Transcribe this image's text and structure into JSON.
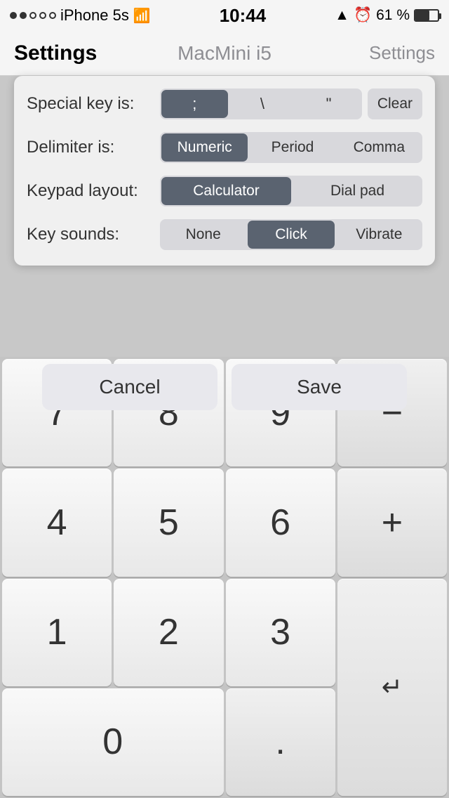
{
  "statusBar": {
    "carrier": "iPhone 5s",
    "time": "10:44",
    "battery": "61 %"
  },
  "navBar": {
    "titleLeft": "Settings",
    "titleCenter": "MacMini i5",
    "titleRight": "Settings"
  },
  "settings": {
    "specialKeyLabel": "Special key is:",
    "delimiterLabel": "Delimiter is:",
    "keypadLayoutLabel": "Keypad layout:",
    "keySoundsLabel": "Key sounds:",
    "specialKeyOptions": [
      ";",
      "\\",
      "\""
    ],
    "specialKeyActiveIndex": 0,
    "clearLabel": "Clear",
    "delimiterOptions": [
      "Numeric",
      "Period",
      "Comma"
    ],
    "delimiterActiveIndex": 0,
    "keypadOptions": [
      "Calculator",
      "Dial pad"
    ],
    "keypadActiveIndex": 0,
    "keySoundsOptions": [
      "None",
      "Click",
      "Vibrate"
    ],
    "keySoundsActiveIndex": 1
  },
  "dialog": {
    "cancelLabel": "Cancel",
    "saveLabel": "Save"
  },
  "keypad": {
    "keys": [
      "7",
      "8",
      "9",
      "-",
      "4",
      "5",
      "6",
      "+",
      "1",
      "2",
      "3",
      "0",
      ".",
      "↵"
    ]
  }
}
